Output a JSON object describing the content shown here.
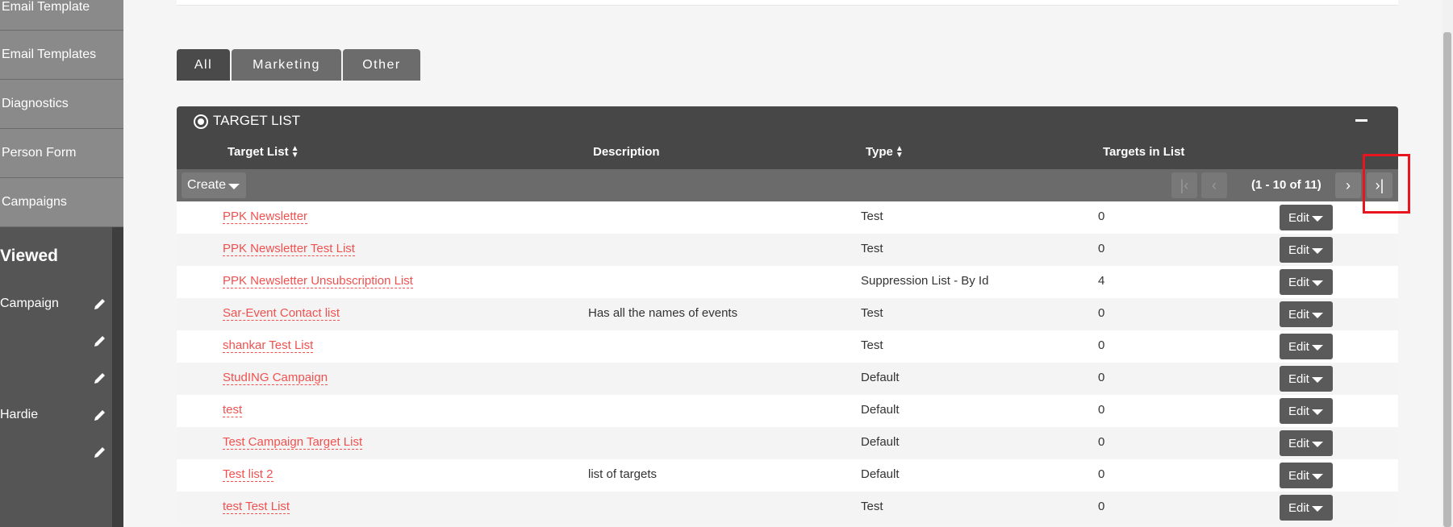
{
  "sidebar": {
    "menu": [
      "Email Template",
      "Email Templates",
      "Diagnostics",
      "Person Form",
      "Campaigns"
    ],
    "recent_title": "Viewed",
    "recent": [
      "Campaign",
      "",
      "",
      "Hardie",
      ""
    ]
  },
  "tabs": [
    "All",
    "Marketing",
    "Other"
  ],
  "panel": {
    "title": "TARGET LIST",
    "columns": {
      "target_list": "Target List",
      "description": "Description",
      "type": "Type",
      "targets_in_list": "Targets in List"
    },
    "create_label": "Create",
    "pagination": "(1 - 10 of 11)",
    "edit_label": "Edit",
    "rows": [
      {
        "name": "PPK Newsletter",
        "description": "",
        "type": "Test",
        "count": "0"
      },
      {
        "name": "PPK Newsletter Test List",
        "description": "",
        "type": "Test",
        "count": "0"
      },
      {
        "name": "PPK Newsletter Unsubscription List",
        "description": "",
        "type": "Suppression List - By Id",
        "count": "4"
      },
      {
        "name": "Sar-Event Contact list",
        "description": "Has all the names of events",
        "type": "Test",
        "count": "0"
      },
      {
        "name": "shankar Test List",
        "description": "",
        "type": "Test",
        "count": "0"
      },
      {
        "name": "StudING Campaign",
        "description": "",
        "type": "Default",
        "count": "0"
      },
      {
        "name": "test",
        "description": "",
        "type": "Default",
        "count": "0"
      },
      {
        "name": "Test Campaign Target List",
        "description": "",
        "type": "Default",
        "count": "0"
      },
      {
        "name": "Test list 2",
        "description": "list of targets",
        "type": "Default",
        "count": "0"
      },
      {
        "name": "test Test List",
        "description": "",
        "type": "Test",
        "count": "0"
      }
    ]
  }
}
